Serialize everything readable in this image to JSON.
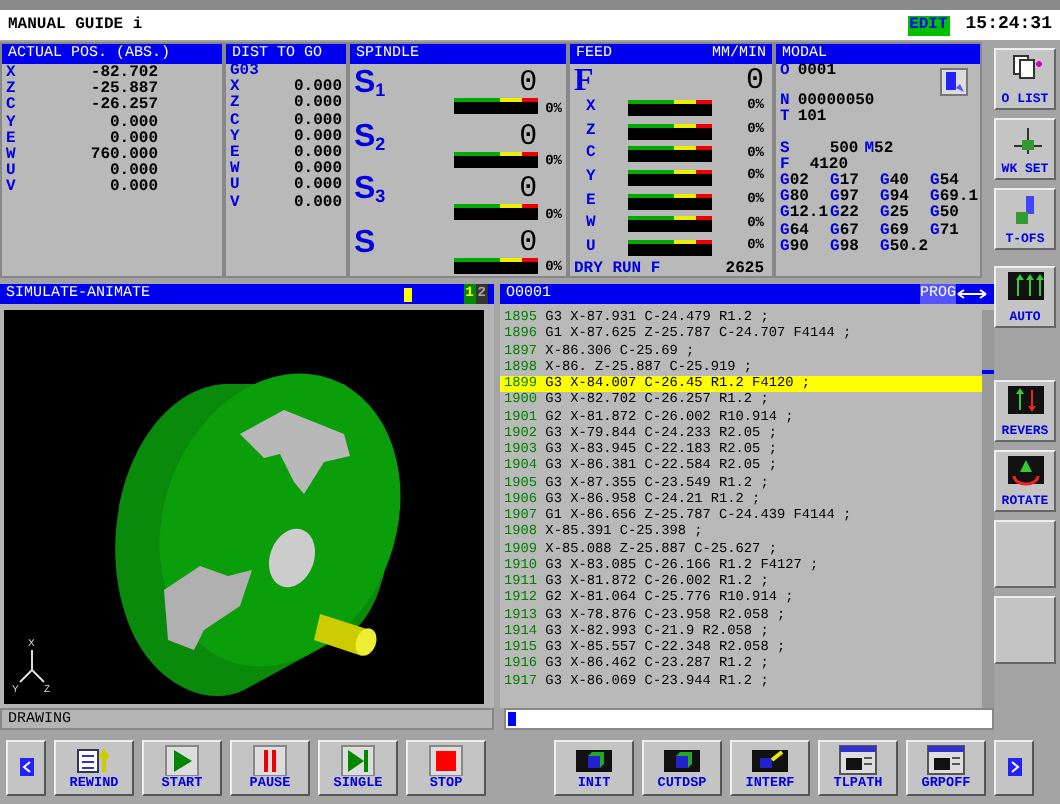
{
  "header": {
    "title": "MANUAL GUIDE i",
    "mode": "EDIT",
    "time": "15:24:31"
  },
  "actual_pos": {
    "title": "ACTUAL POS. (ABS.)",
    "axes": [
      {
        "axis": "X",
        "value": "-82.702"
      },
      {
        "axis": "Z",
        "value": "-25.887"
      },
      {
        "axis": "C",
        "value": "-26.257"
      },
      {
        "axis": "Y",
        "value": "0.000"
      },
      {
        "axis": "E",
        "value": "0.000"
      },
      {
        "axis": "W",
        "value": "760.000"
      },
      {
        "axis": "U",
        "value": "0.000"
      },
      {
        "axis": "V",
        "value": "0.000"
      }
    ]
  },
  "dist_to_go": {
    "title": "DIST TO GO",
    "gcode": "G03",
    "axes": [
      {
        "axis": "X",
        "value": "0.000"
      },
      {
        "axis": "Z",
        "value": "0.000"
      },
      {
        "axis": "C",
        "value": "0.000"
      },
      {
        "axis": "Y",
        "value": "0.000"
      },
      {
        "axis": "E",
        "value": "0.000"
      },
      {
        "axis": "W",
        "value": "0.000"
      },
      {
        "axis": "U",
        "value": "0.000"
      },
      {
        "axis": "V",
        "value": "0.000"
      }
    ]
  },
  "spindle": {
    "title": "SPINDLE",
    "spindles": [
      {
        "label": "S$_{1}$",
        "value": "0",
        "level": 0,
        "percent": "0%"
      },
      {
        "label": "S$_{2}$",
        "value": "0",
        "level": 0,
        "percent": "0%"
      },
      {
        "label": "S$_{3}$",
        "value": "0",
        "level": 0,
        "percent": "0%"
      },
      {
        "label": "S",
        "value": "0",
        "level": 0,
        "percent": "0%"
      }
    ]
  },
  "feed": {
    "title": "FEED",
    "unit": "MM/MIN",
    "label": "F",
    "value": "0",
    "axes": [
      {
        "axis": "X",
        "level": 0,
        "percent": "0%"
      },
      {
        "axis": "Z",
        "level": 0,
        "percent": "0%"
      },
      {
        "axis": "C",
        "level": 0,
        "percent": "0%"
      },
      {
        "axis": "Y",
        "level": 0,
        "percent": "0%"
      },
      {
        "axis": "E",
        "level": 0,
        "percent": "0%"
      },
      {
        "axis": "W",
        "level": 0,
        "percent": "0%"
      },
      {
        "axis": "U",
        "level": 0,
        "percent": "0%"
      }
    ],
    "dry_run": {
      "label": "DRY RUN F",
      "value": "2625"
    }
  },
  "modal": {
    "title": "MODAL",
    "lines": [
      {
        "letter": "O",
        "value": "0001"
      },
      {
        "letter": "N",
        "value": "00000050"
      },
      {
        "letter": "T",
        "value": "101"
      },
      {
        "letter": "S",
        "value": "500",
        "extra": "M52"
      },
      {
        "letter": "F",
        "value": "4120"
      }
    ],
    "gcodes": [
      "G02",
      "G17",
      "G40",
      "G54",
      "G80",
      "G97",
      "G94",
      "G69.1",
      "G12.1",
      "G22",
      "G25",
      "G50",
      "G64",
      "G67",
      "G69",
      "G71",
      "G90",
      "G98",
      "G50.2"
    ]
  },
  "side_buttons": [
    {
      "kind": "key",
      "label": "O LIST"
    },
    {
      "kind": "key",
      "label": "WK SET"
    },
    {
      "kind": "key",
      "label": "T-OFS"
    },
    {
      "kind": "key",
      "label": "AUTO"
    },
    {
      "kind": "key",
      "label": "REVERS"
    },
    {
      "kind": "key",
      "label": "ROTATE"
    },
    {
      "kind": "blank"
    },
    {
      "kind": "blank"
    }
  ],
  "simulation": {
    "title": "SIMULATE-ANIMATE",
    "views": [
      {
        "label": "1",
        "selected": true
      },
      {
        "label": "2",
        "selected": false
      }
    ],
    "axes": [
      "X",
      "Y",
      "Z"
    ],
    "status": "DRAWING"
  },
  "program": {
    "title": "O0001",
    "mode": "PROG",
    "lines": [
      {
        "number": "1895",
        "code": "G3 X-87.931 C-24.479 R1.2 ;",
        "selected": false
      },
      {
        "number": "1896",
        "code": "G1 X-87.625 Z-25.787 C-24.707 F4144 ;",
        "selected": false
      },
      {
        "number": "1897",
        "code": "X-86.306 C-25.69 ;",
        "selected": false
      },
      {
        "number": "1898",
        "code": "X-86. Z-25.887 C-25.919 ;",
        "selected": false
      },
      {
        "number": "1899",
        "code": "G3 X-84.007 C-26.45 R1.2 F4120 ;",
        "selected": true
      },
      {
        "number": "1900",
        "code": "G3 X-82.702 C-26.257 R1.2 ;",
        "selected": false
      },
      {
        "number": "1901",
        "code": "G2 X-81.872 C-26.002 R10.914 ;",
        "selected": false
      },
      {
        "number": "1902",
        "code": "G3 X-79.844 C-24.233 R2.05 ;",
        "selected": false
      },
      {
        "number": "1903",
        "code": "G3 X-83.945 C-22.183 R2.05 ;",
        "selected": false
      },
      {
        "number": "1904",
        "code": "G3 X-86.381 C-22.584 R2.05 ;",
        "selected": false
      },
      {
        "number": "1905",
        "code": "G3 X-87.355 C-23.549 R1.2 ;",
        "selected": false
      },
      {
        "number": "1906",
        "code": "G3 X-86.958 C-24.21 R1.2 ;",
        "selected": false
      },
      {
        "number": "1907",
        "code": "G1 X-86.656 Z-25.787 C-24.439 F4144 ;",
        "selected": false
      },
      {
        "number": "1908",
        "code": "X-85.391 C-25.398 ;",
        "selected": false
      },
      {
        "number": "1909",
        "code": "X-85.088 Z-25.887 C-25.627 ;",
        "selected": false
      },
      {
        "number": "1910",
        "code": "G3 X-83.085 C-26.166 R1.2 F4127 ;",
        "selected": false
      },
      {
        "number": "1911",
        "code": "G3 X-81.872 C-26.002 R1.2 ;",
        "selected": false
      },
      {
        "number": "1912",
        "code": "G2 X-81.064 C-25.776 R10.914 ;",
        "selected": false
      },
      {
        "number": "1913",
        "code": "G3 X-78.876 C-23.958 R2.058 ;",
        "selected": false
      },
      {
        "number": "1914",
        "code": "G3 X-82.993 C-21.9 R2.058 ;",
        "selected": false
      },
      {
        "number": "1915",
        "code": "G3 X-85.557 C-22.348 R2.058 ;",
        "selected": false
      },
      {
        "number": "1916",
        "code": "G3 X-86.462 C-23.287 R1.2 ;",
        "selected": false
      },
      {
        "number": "1917",
        "code": "G3 X-86.069 C-23.944 R1.2 ;",
        "selected": false
      }
    ]
  },
  "softkeys": {
    "left": [
      {
        "label": "REWIND"
      },
      {
        "label": "START"
      },
      {
        "label": "PAUSE"
      },
      {
        "label": "SINGLE"
      },
      {
        "label": "STOP"
      }
    ],
    "right": [
      {
        "label": "INIT"
      },
      {
        "label": "CUTDSP"
      },
      {
        "label": "INTERF"
      },
      {
        "label": "TLPATH"
      },
      {
        "label": "GRPOFF"
      }
    ]
  }
}
